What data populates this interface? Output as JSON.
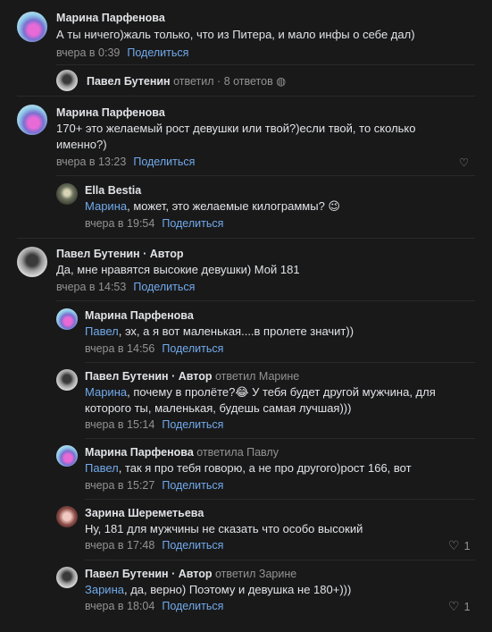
{
  "share_label": "Поделиться",
  "comments": [
    {
      "author": "Марина Парфенова",
      "text": "А ты ничего)жаль только, что из Питера, и мало инфы о себе дал)",
      "time": "вчера в 0:39"
    },
    {
      "thread_summary": {
        "author": "Павел Бутенин",
        "action": "ответил",
        "dot": "·",
        "count": "8 ответов"
      }
    },
    {
      "author": "Марина Парфенова",
      "text": "170+ это желаемый рост девушки или твой?)если твой, то сколько именно?)",
      "time": "вчера в 13:23"
    },
    {
      "author": "Ella Bestia",
      "mention": "Марина",
      "text": ", может, это желаемые килограммы? 😉",
      "time": "вчера в 19:54"
    },
    {
      "author": "Павел Бутенин · Автор",
      "text": "Да, мне нравятся высокие девушки) Мой 181",
      "time": "вчера в 14:53"
    },
    {
      "author": "Марина Парфенова",
      "mention": "Павел",
      "text": ", эх, а я вот маленькая....в пролете значит))",
      "time": "вчера в 14:56"
    },
    {
      "author": "Павел Бутенин · Автор",
      "replied": "ответил Марине",
      "mention": "Марина",
      "text": ", почему в пролёте?😂 У тебя будет другой мужчина, для которого ты, маленькая, будешь самая лучшая)))",
      "time": "вчера в 15:14"
    },
    {
      "author": "Марина Парфенова",
      "replied": "ответила Павлу",
      "mention": "Павел",
      "text": ", так я про тебя говорю, а не про другого)рост 166, вот",
      "time": "вчера в 15:27"
    },
    {
      "author": "Зарина Шереметьева",
      "text": "Ну, 181 для мужчины не сказать что особо высокий",
      "time": "вчера в 17:48",
      "likes": "1"
    },
    {
      "author": "Павел Бутенин · Автор",
      "replied": "ответил Зарине",
      "mention": "Зарина",
      "text": ", да, верно) Поэтому и девушка не 180+)))",
      "time": "вчера в 18:04",
      "likes": "1"
    }
  ]
}
